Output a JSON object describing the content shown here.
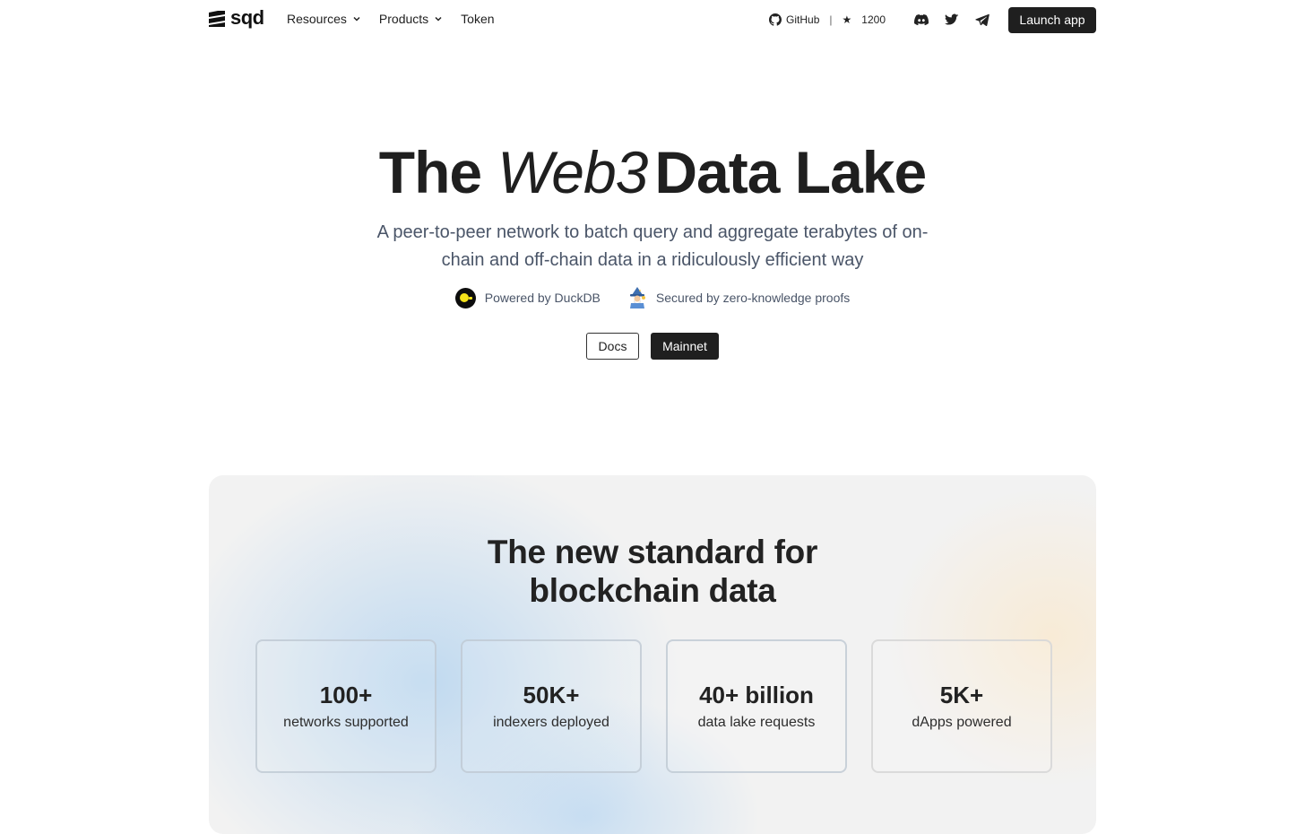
{
  "nav": {
    "logo_text": "sqd",
    "menu": [
      {
        "label": "Resources",
        "has_dropdown": true
      },
      {
        "label": "Products",
        "has_dropdown": true
      },
      {
        "label": "Token",
        "has_dropdown": false
      }
    ],
    "github_label": "GitHub",
    "github_separator": "|",
    "star_icon": "★",
    "github_stars": "1200",
    "socials": [
      "discord-icon",
      "twitter-icon",
      "telegram-icon"
    ],
    "launch_label": "Launch app"
  },
  "hero": {
    "title_pre": "The",
    "title_italic": "Web3",
    "title_post": "Data Lake",
    "subtitle": "A peer-to-peer network to batch query and aggregate terabytes of on-chain and off-chain data in a ridiculously efficient way",
    "badges": [
      {
        "icon": "duckdb-icon",
        "label": "Powered by DuckDB"
      },
      {
        "icon": "wizard-icon",
        "label": "Secured by zero-knowledge proofs"
      }
    ],
    "docs_label": "Docs",
    "mainnet_label": "Mainnet"
  },
  "stats": {
    "title": "The new standard for blockchain data",
    "cards": [
      {
        "value": "100+",
        "label": "networks supported"
      },
      {
        "value": "50K+",
        "label": "indexers deployed"
      },
      {
        "value": "40+ billion",
        "label": "data lake requests"
      },
      {
        "value": "5K+",
        "label": "dApps powered"
      }
    ]
  },
  "colors": {
    "primary_dark": "#1f1f1f",
    "subtitle_text": "#4a5568",
    "panel_bg": "#f2f2f2",
    "panel_blue_glow": "#bdd8f0",
    "panel_warm_glow": "#ffe2b4",
    "duckdb_yellow": "#f5e31a"
  }
}
